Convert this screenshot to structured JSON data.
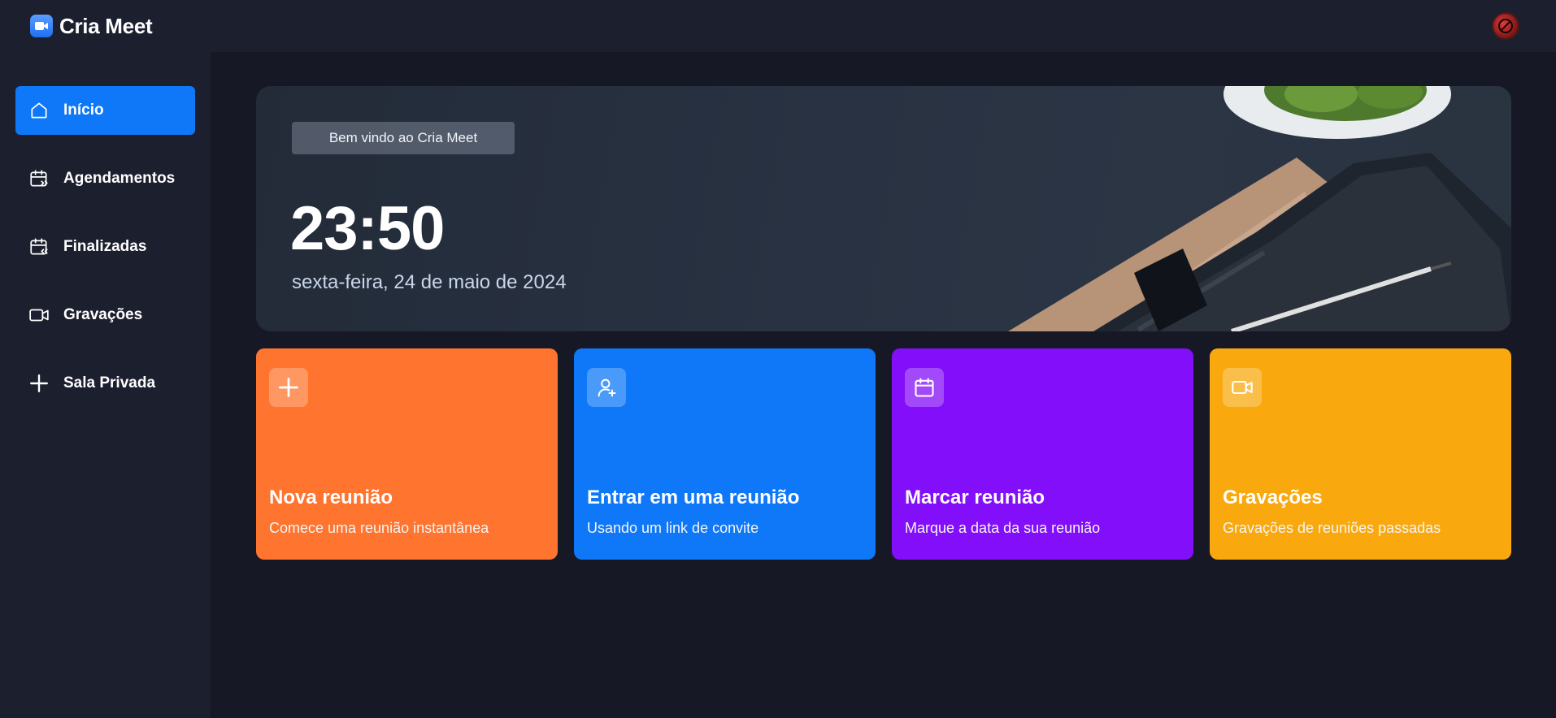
{
  "app": {
    "title": "Cria Meet",
    "logo_icon": "video-camera-icon",
    "accent": "#0e78f9"
  },
  "header": {
    "avatar_icon": "user-avatar-icon"
  },
  "sidebar": {
    "items": [
      {
        "label": "Início",
        "icon": "home-icon",
        "active": true
      },
      {
        "label": "Agendamentos",
        "icon": "calendar-upcoming-icon",
        "active": false
      },
      {
        "label": "Finalizadas",
        "icon": "calendar-previous-icon",
        "active": false
      },
      {
        "label": "Gravações",
        "icon": "video-icon",
        "active": false
      },
      {
        "label": "Sala Privada",
        "icon": "plus-icon",
        "active": false
      }
    ]
  },
  "hero": {
    "badge": "Bem vindo ao Cria Meet",
    "time": "23:50",
    "date": "sexta-feira, 24 de maio de 2024"
  },
  "cards": [
    {
      "title": "Nova reunião",
      "subtitle": "Comece uma reunião instantânea",
      "icon": "plus-icon",
      "color": "#ff742e"
    },
    {
      "title": "Entrar em uma reunião",
      "subtitle": "Usando um link de convite",
      "icon": "user-add-icon",
      "color": "#0e78f9"
    },
    {
      "title": "Marcar reunião",
      "subtitle": "Marque a data da sua reunião",
      "icon": "calendar-icon",
      "color": "#830ef9"
    },
    {
      "title": "Gravações",
      "subtitle": "Gravações de reuniões passadas",
      "icon": "video-icon",
      "color": "#f9a90e"
    }
  ]
}
